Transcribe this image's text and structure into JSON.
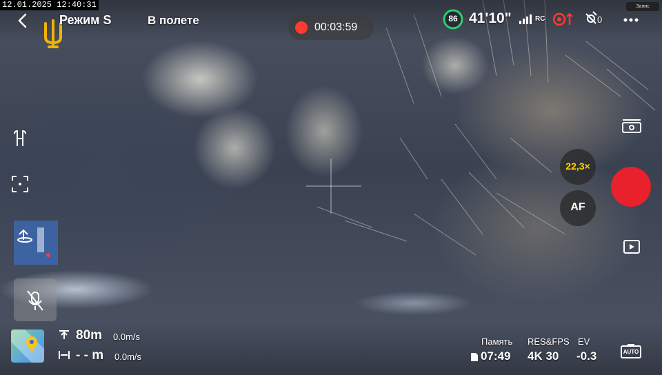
{
  "overlay": {
    "timestamp": "12.01.2025 12:40:31"
  },
  "header": {
    "mode": "Режим S",
    "flight_state": "В полете",
    "recording_time": "00:03:59",
    "battery_percent": "86",
    "flight_time": "41'10\"",
    "rc_label": "RC",
    "gps_count": "0",
    "badge_text": "Запис"
  },
  "telemetry": {
    "altitude": "80m",
    "vertical_speed": "0.0m/s",
    "distance": "- - m",
    "horizontal_speed": "0.0m/s"
  },
  "camera_controls": {
    "zoom": "22,3×",
    "focus_mode": "AF"
  },
  "camera_info": {
    "memory_label": "Память",
    "memory_value": "07:49",
    "res_fps_label": "RES&FPS",
    "res_fps_value": "4K 30",
    "ev_label": "EV",
    "ev_value": "-0.3",
    "auto_label": "AUTO"
  },
  "colors": {
    "record_red": "#e8212c",
    "zoom_yellow": "#ffd200",
    "battery_green": "#2ecc71",
    "warning_red": "#ff3b30"
  }
}
